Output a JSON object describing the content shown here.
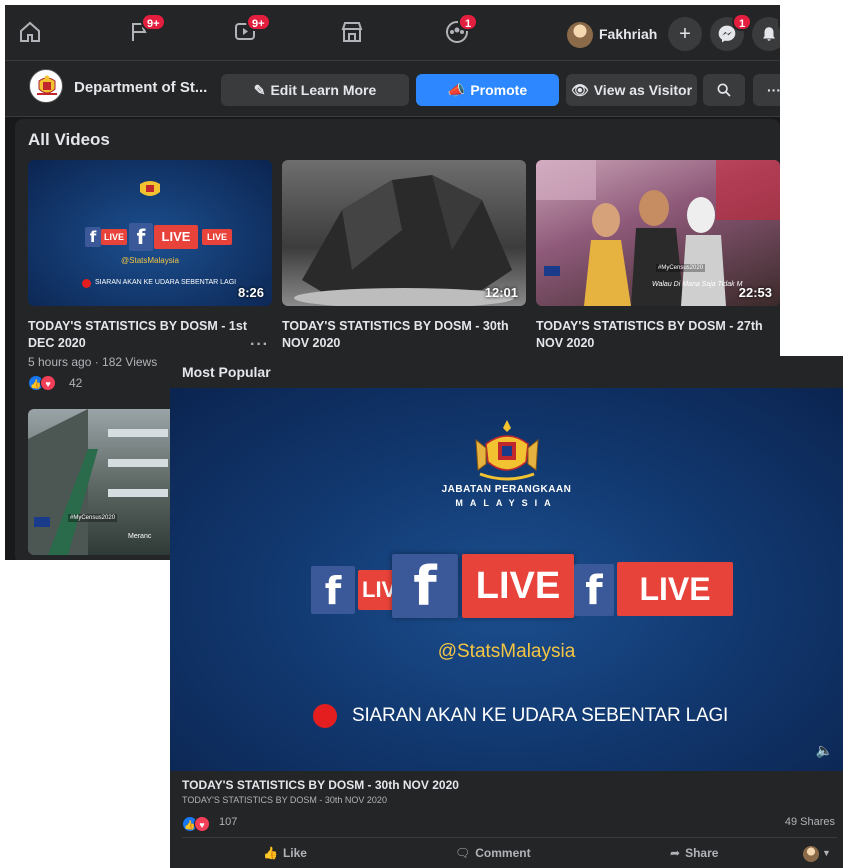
{
  "nav": {
    "badges": {
      "pages": "9+",
      "watch": "9+",
      "groups": "1",
      "messenger": "1"
    },
    "profile_name": "Fakhriah"
  },
  "page": {
    "name": "Department of St...",
    "buttons": {
      "edit": "Edit Learn More",
      "promote": "Promote",
      "visitor": "View as Visitor"
    }
  },
  "all_videos": {
    "title": "All Videos",
    "videos": [
      {
        "title": "TODAY'S STATISTICS BY DOSM - 1st DEC 2020",
        "duration": "8:26",
        "meta": "5 hours ago · 182 Views",
        "reactions": "42"
      },
      {
        "title": "TODAY'S STATISTICS BY DOSM - 30th NOV 2020",
        "duration": "12:01"
      },
      {
        "title": "TODAY'S STATISTICS BY DOSM - 27th NOV 2020",
        "duration": "22:53"
      }
    ],
    "thumb_texts": {
      "agency": "JABATAN PERANGKAAN MALAYSIA",
      "live": "LIVE",
      "handle": "@StatsMalaysia",
      "siaran": "SIARAN AKAN KE UDARA SEBENTAR LAGI",
      "hashtag": "#MyCensus2020",
      "caption3": "Walau Di Mana Saja Tidak M",
      "caption4": "Meranc"
    }
  },
  "most_popular": {
    "title": "Most Popular",
    "player": {
      "agency": "JABATAN PERANGKAAN",
      "country": "MALAYSIA",
      "live": "LIVE",
      "handle": "@StatsMalaysia",
      "siaran": "SIARAN AKAN KE UDARA SEBENTAR LAGI"
    },
    "video_title": "TODAY'S STATISTICS BY DOSM - 30th NOV 2020",
    "video_subtitle": "TODAY'S STATISTICS BY DOSM - 30th NOV 2020",
    "reactions": "107",
    "shares": "49 Shares",
    "actions": {
      "like": "Like",
      "comment": "Comment",
      "share": "Share"
    }
  },
  "colors": {
    "accent": "#2d88ff",
    "live_red": "#e8433a",
    "facebook_blue": "#3b5998",
    "badge_red": "#e41e3f"
  }
}
